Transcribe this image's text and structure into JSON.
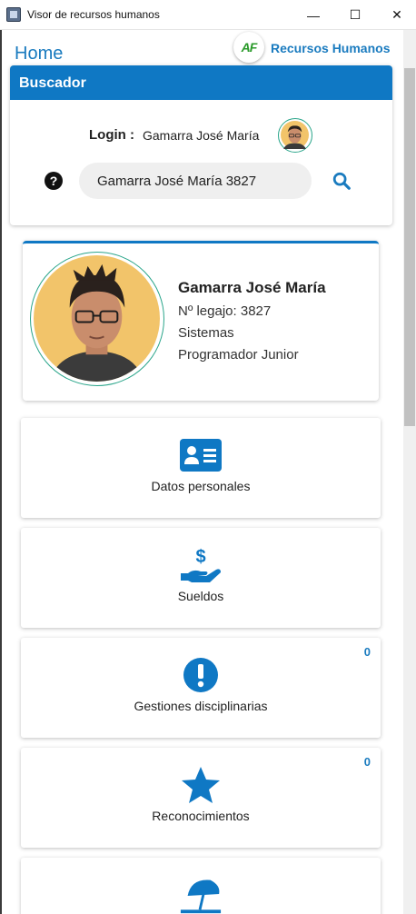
{
  "window": {
    "title": "Visor de recursos humanos",
    "minimize_glyph": "—",
    "maximize_glyph": "☐",
    "close_glyph": "✕"
  },
  "header": {
    "home_label": "Home",
    "brand_mark": "AF",
    "brand_name": "Recursos Humanos"
  },
  "search_card": {
    "title": "Buscador",
    "login_label": "Login :",
    "login_name": "Gamarra José María",
    "help_glyph": "?",
    "search_value": "Gamarra José María 3827",
    "search_icon": "search-icon"
  },
  "profile": {
    "name": "Gamarra José María",
    "legajo": "Nº legajo: 3827",
    "department": "Sistemas",
    "position": "Programador Junior"
  },
  "tiles": [
    {
      "label": "Datos personales",
      "icon": "id-card-icon",
      "count": ""
    },
    {
      "label": "Sueldos",
      "icon": "hand-dollar-icon",
      "count": ""
    },
    {
      "label": "Gestiones disciplinarias",
      "icon": "exclamation-circle-icon",
      "count": "0"
    },
    {
      "label": "Reconocimientos",
      "icon": "star-icon",
      "count": "0"
    },
    {
      "label": "",
      "icon": "umbrella-beach-icon",
      "count": ""
    }
  ],
  "colors": {
    "primary": "#0f78c4",
    "link": "#1a7bbf",
    "avatar_ring": "#2aa58a",
    "brand_green": "#2a9a2a"
  }
}
